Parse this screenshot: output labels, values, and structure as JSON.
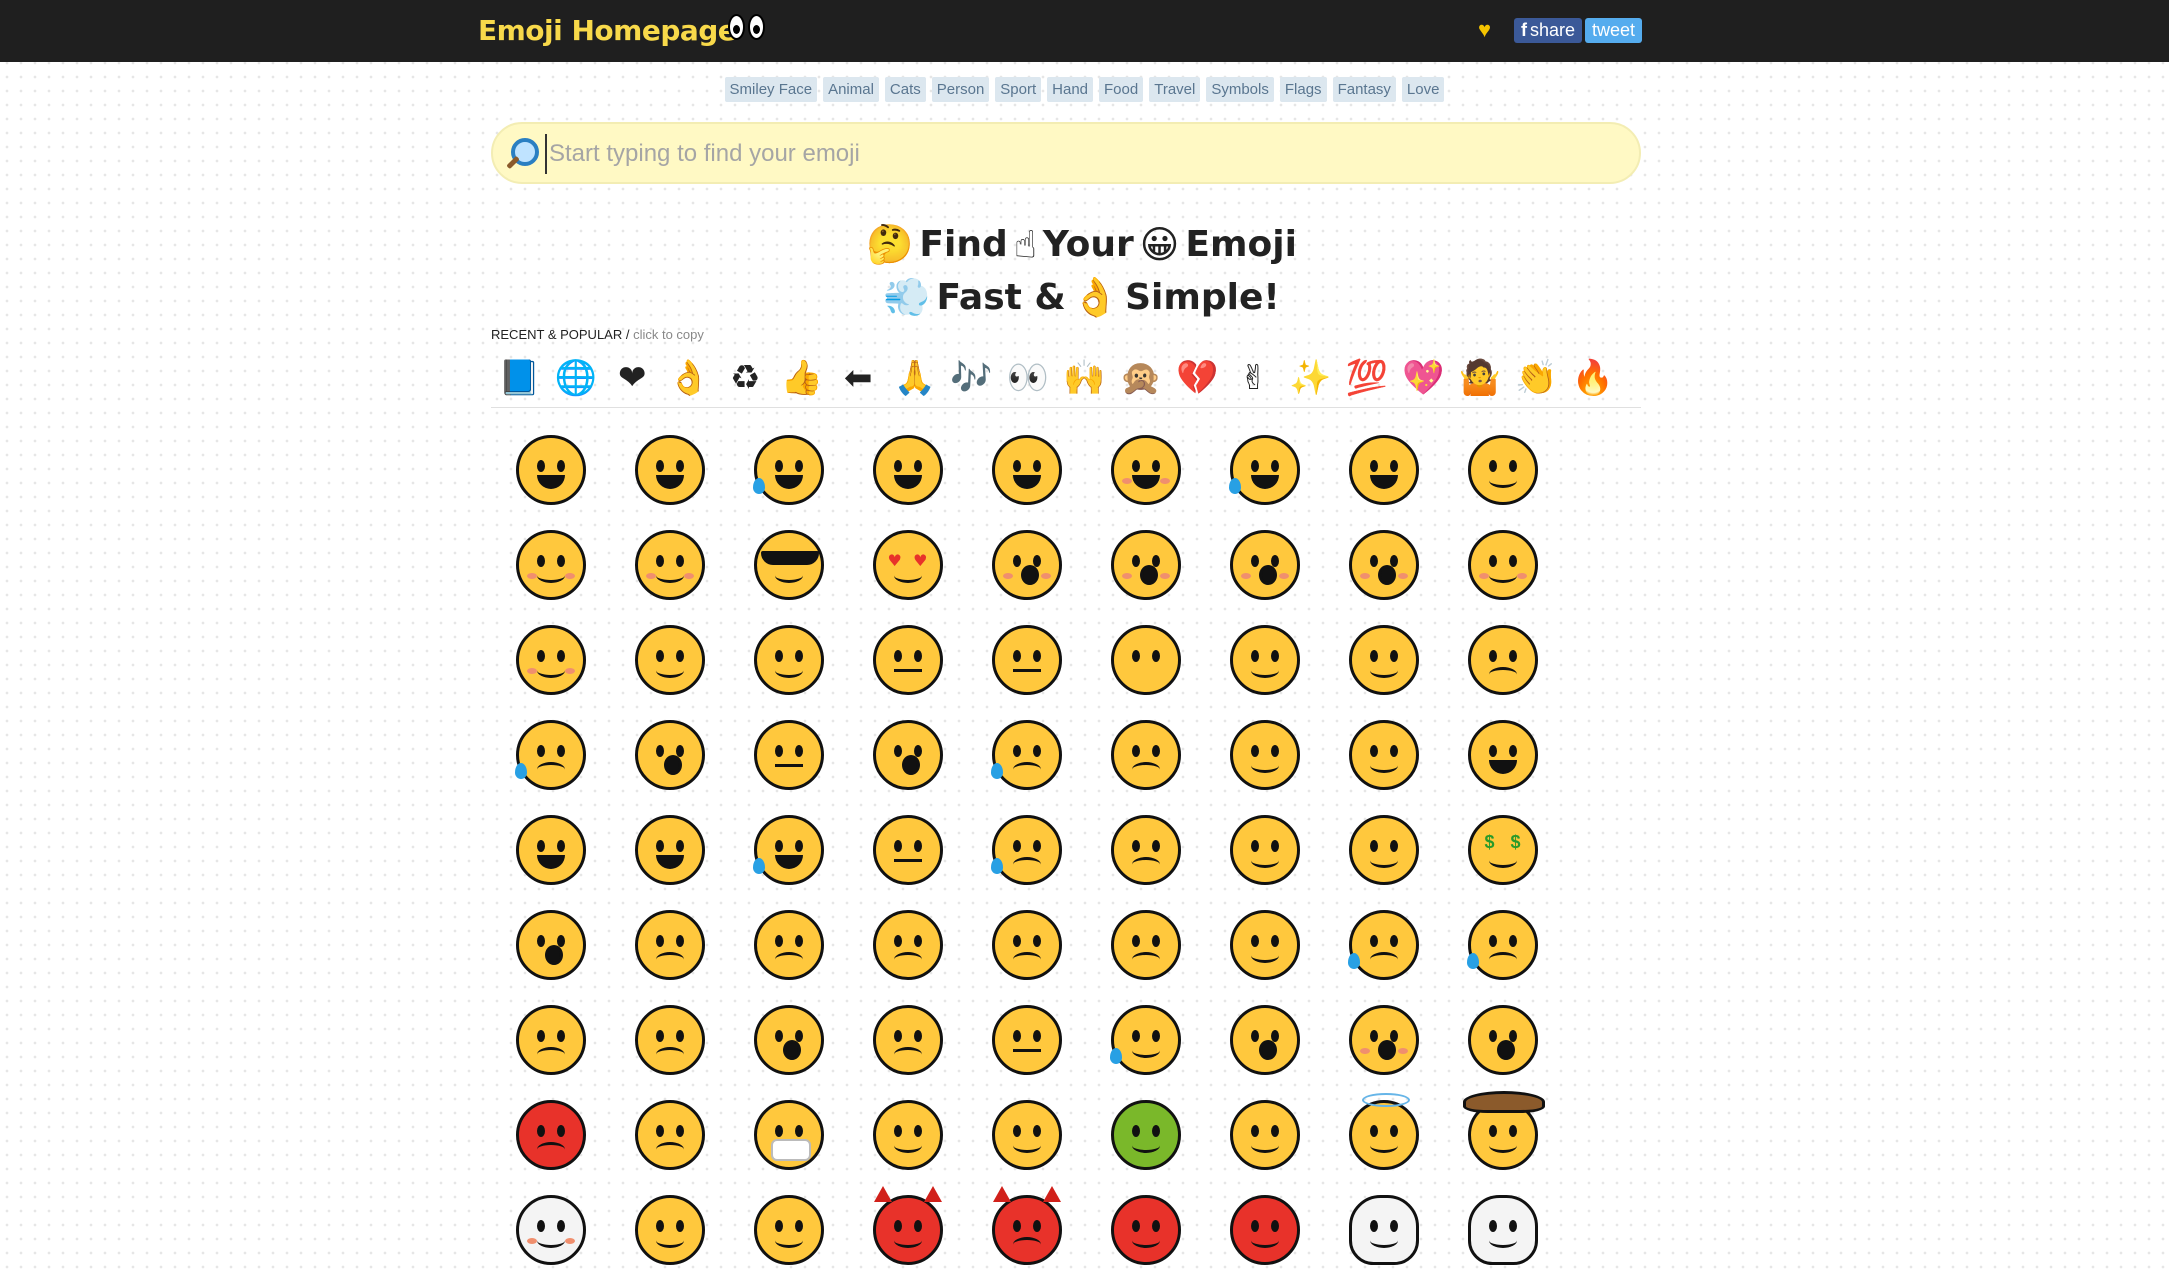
{
  "header": {
    "brand": "Emoji Homepage",
    "heart": "♥",
    "share_prefix": "f",
    "share_label": "share",
    "tweet_label": "tweet"
  },
  "categories": [
    "Smiley Face",
    "Animal",
    "Cats",
    "Person",
    "Sport",
    "Hand",
    "Food",
    "Travel",
    "Symbols",
    "Flags",
    "Fantasy",
    "Love"
  ],
  "search": {
    "placeholder": "Start typing to find your emoji",
    "value": ""
  },
  "hero": {
    "line1": {
      "e1": "🤔",
      "w1": "Find",
      "e2": "☝",
      "w2": "Your",
      "e3": "😀",
      "w3": "Emoji"
    },
    "line2": {
      "e1": "💨",
      "w1": "Fast &",
      "e2": "👌",
      "w2": "Simple!"
    }
  },
  "recent": {
    "label": "RECENT & POPULAR /",
    "sublabel": "click to copy",
    "items": [
      "📘",
      "🌐",
      "❤",
      "👌",
      "♻",
      "👍",
      "⬅",
      "🙏",
      "🎶",
      "👀",
      "🙌",
      "🙊",
      "💔",
      "✌",
      "✨",
      "💯",
      "💖",
      "🤷",
      "👏",
      "🔥"
    ]
  },
  "grid": {
    "rows": 9,
    "columns": 9,
    "items": [
      "grinning-face",
      "beaming-face",
      "face-with-tears-of-joy",
      "rolling-on-floor-laughing",
      "grinning-big-eyes",
      "grinning-smiling-eyes",
      "grinning-sweat",
      "squinting-face",
      "winking-face",
      "smiling-eyes",
      "face-savoring-food",
      "smiling-sunglasses",
      "heart-eyes",
      "face-blowing-kiss",
      "kissing-face",
      "kissing-smiling-eyes",
      "kissing-closed-eyes",
      "smiling-face",
      "slightly-smiling-face",
      "hugging-face",
      "thinking-face",
      "neutral-face",
      "expressionless-face",
      "face-without-mouth",
      "rolling-eyes",
      "smirking-face",
      "persevering-face",
      "sad-relieved-face",
      "hushed-face",
      "zipper-mouth-face",
      "hushed-face-2",
      "sleepy-face",
      "tired-face",
      "sleeping-face",
      "relieved-face",
      "face-with-tongue",
      "winking-tongue",
      "squinting-tongue",
      "drooling-face",
      "unamused-face",
      "downcast-sweat",
      "pensive-face",
      "confused-face",
      "upside-down-face",
      "money-mouth-face",
      "astonished-face",
      "frowning-face",
      "slightly-frowning-face",
      "confounded-face",
      "disappointed-face",
      "worried-face",
      "face-with-steam",
      "crying-face",
      "loudly-crying-face",
      "frowning-open-mouth",
      "anguished-face",
      "fearful-face",
      "weary-face",
      "grimacing-face",
      "anxious-sweat",
      "screaming-face",
      "flushed-face",
      "dizzy-face",
      "pouting-face",
      "angry-face",
      "face-with-mask",
      "thermometer-face",
      "head-bandage",
      "nauseated-face",
      "sneezing-face",
      "smiling-halo",
      "cowboy-face",
      "clown-face",
      "lying-face",
      "nerd-face",
      "smiling-devil",
      "angry-devil",
      "ogre",
      "goblin",
      "skull",
      "skull-crossbones"
    ]
  }
}
